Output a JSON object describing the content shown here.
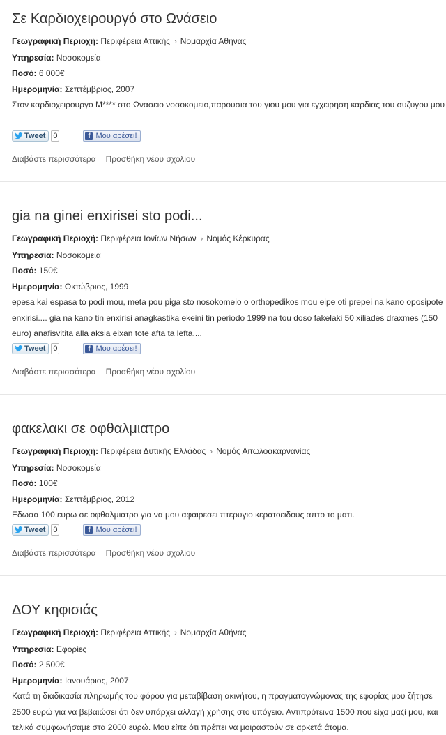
{
  "labels": {
    "region": "Γεωγραφική Περιοχή:",
    "service": "Υπηρεσία:",
    "amount": "Ποσό:",
    "date": "Ημερομηνία:"
  },
  "social": {
    "tweet_label": "Tweet",
    "like_label": "Μου αρέσει!"
  },
  "actions": {
    "read_more": "Διαβάστε περισσότερα",
    "add_comment": "Προσθήκη νέου σχολίου"
  },
  "posts": [
    {
      "title": "Σε Καρδιοχειρουργό στο Ωνάσειο",
      "region": "Περιφέρεια Αττικής",
      "subregion": "Νομαρχία Αθήνας",
      "service": "Νοσοκομεία",
      "amount": "6 000€",
      "date": "Σεπτέμβριος, 2007",
      "text": "Στον καρδιοχειρουργο M**** στο Ωνασειο νοσοκομειο,παρουσια του γιου μου για εγχειρηση καρδιας του συζυγου μου",
      "tweet_count": "0"
    },
    {
      "title": "gia na ginei enxirisei sto podi...",
      "region": "Περιφέρεια Ιονίων Νήσων",
      "subregion": "Νομός Κέρκυρας",
      "service": "Νοσοκομεία",
      "amount": "150€",
      "date": "Οκτώβριος, 1999",
      "text": "epesa kai espasa to podi mou, meta pou piga sto nosokomeio o orthopedikos mou eipe oti prepei na kano oposipote enxirisi.... gia na kano tin enxirisi anagkastika ekeini tin periodo 1999 na tou doso fakelaki 50 xiliades draxmes (150 euro) anafisvitita alla aksia eixan tote afta ta lefta....",
      "tweet_count": "0"
    },
    {
      "title": "φακελακι σε οφθαλμιατρο",
      "region": "Περιφέρεια Δυτικής Ελλάδας",
      "subregion": "Νομός Αιτωλοακαρνανίας",
      "service": "Νοσοκομεία",
      "amount": "100€",
      "date": "Σεπτέμβριος, 2012",
      "text": "Εδωσα 100 ευρω σε οφθαλμιατρο για να μου αφαιρεσει πτερυγιο κερατοειδους απτο το ματι.",
      "tweet_count": "0"
    },
    {
      "title": "ΔΟΥ κηφισιάς",
      "region": "Περιφέρεια Αττικής",
      "subregion": "Νομαρχία Αθήνας",
      "service": "Εφορίες",
      "amount": "2 500€",
      "date": "Ιανουάριος, 2007",
      "text": "Κατά τη διαδικασία πληρωμής του φόρου για μεταβίβαση ακινήτου, η πραγματογνώμονας της εφορίας μου ζήτησε 2500 ευρώ για να βεβαιώσει ότι δεν υπάρχει αλλαγή χρήσης στο υπόγειο. Αντιπρότεινα 1500 που είχα μαζί μου, και τελικά συμφωνήσαμε στα 2000 ευρώ. Μου είπε ότι πρέπει να μοιραστούν σε αρκετά άτομα.",
      "tweet_count": null
    }
  ]
}
